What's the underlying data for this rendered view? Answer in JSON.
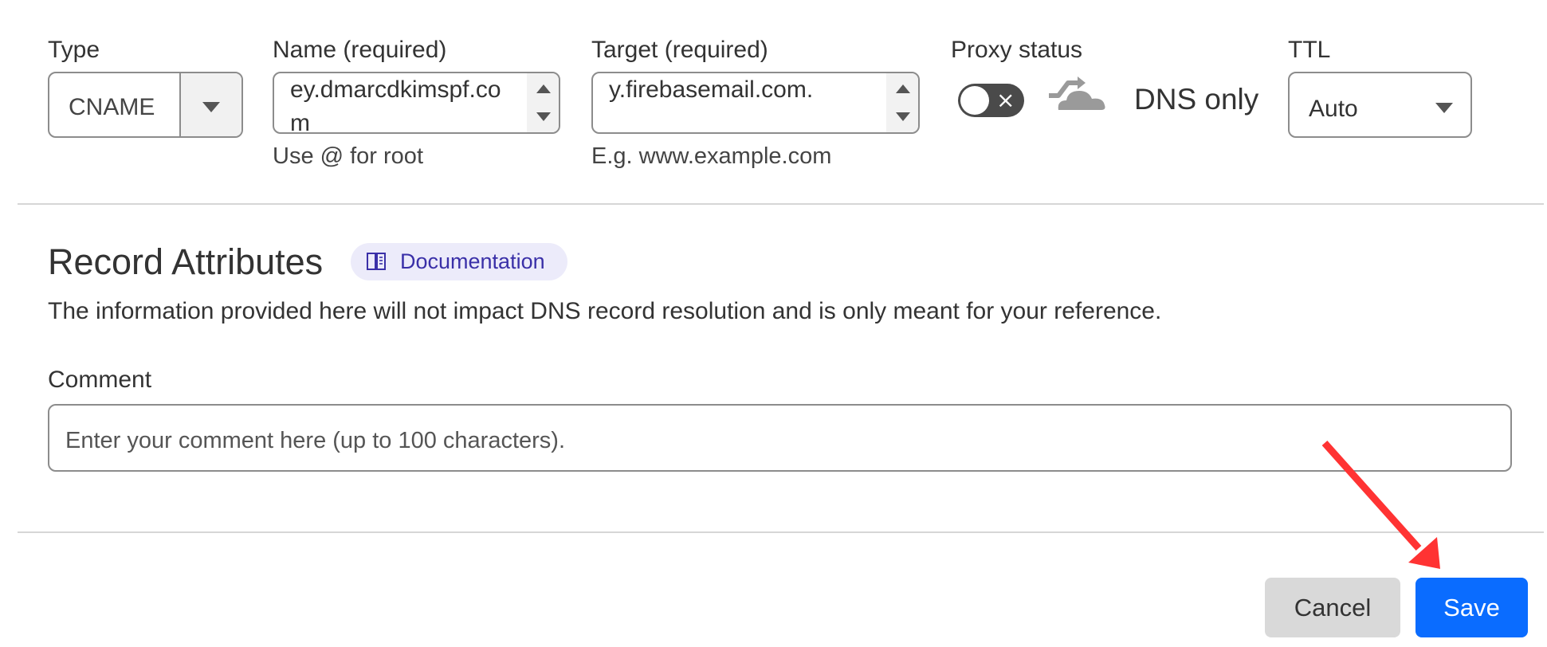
{
  "record": {
    "type": {
      "label": "Type",
      "value": "CNAME"
    },
    "name": {
      "label": "Name (required)",
      "value": "ey.dmarcdkimspf.com",
      "hint": "Use @ for root"
    },
    "target": {
      "label": "Target (required)",
      "value": "y.firebasemail.com.",
      "hint": "E.g. www.example.com"
    },
    "proxy": {
      "label": "Proxy status",
      "toggle_on": false,
      "toggle_glyph": "×",
      "status_text": "DNS only",
      "icon": "cloud-dns-only-icon"
    },
    "ttl": {
      "label": "TTL",
      "value": "Auto"
    }
  },
  "attributes": {
    "title": "Record Attributes",
    "doc_link_label": "Documentation",
    "description": "The information provided here will not impact DNS record resolution and is only meant for your reference.",
    "comment_label": "Comment",
    "comment_value": "",
    "comment_placeholder": "Enter your comment here (up to 100 characters)."
  },
  "actions": {
    "cancel_label": "Cancel",
    "save_label": "Save"
  },
  "colors": {
    "save_bg": "#0a6cff",
    "cancel_bg": "#d9d9d9",
    "doc_badge_bg": "#ecebfa",
    "doc_badge_text": "#3a30a8",
    "annotation_arrow": "#ff3333"
  }
}
